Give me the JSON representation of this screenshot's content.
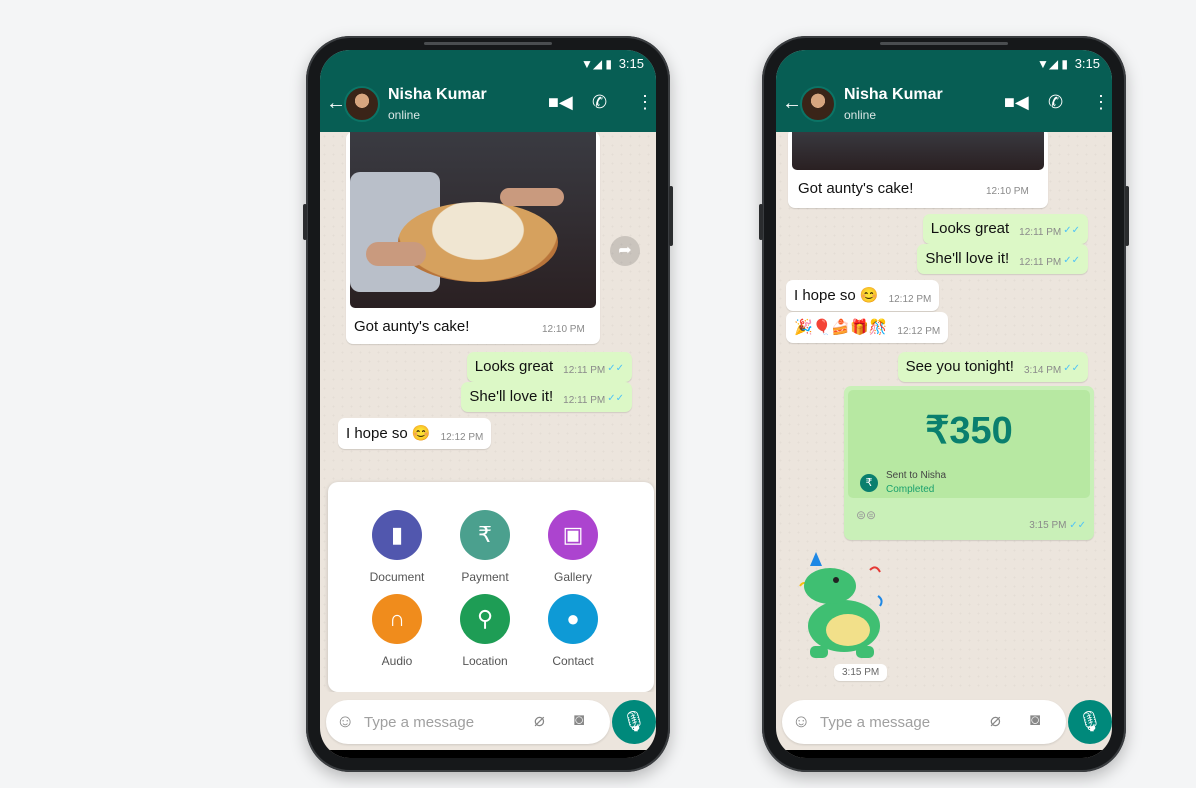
{
  "status_bar": {
    "time": "3:15"
  },
  "contact": {
    "name": "Nisha Kumar",
    "status": "online"
  },
  "left_phone": {
    "image_caption": "Got aunty's cake!",
    "image_caption_time": "12:10 PM",
    "messages": [
      {
        "text": "Looks great",
        "time": "12:11 PM",
        "dir": "out"
      },
      {
        "text": "She'll love it!",
        "time": "12:11 PM",
        "dir": "out"
      },
      {
        "text": "I hope so 😊",
        "time": "12:12 PM",
        "dir": "in"
      }
    ],
    "attachments": [
      {
        "label": "Document",
        "icon": "document-icon",
        "color": "#5157ae"
      },
      {
        "label": "Payment",
        "icon": "rupee-icon",
        "color": "#4ba08e"
      },
      {
        "label": "Gallery",
        "icon": "gallery-icon",
        "color": "#ac44cf"
      },
      {
        "label": "Audio",
        "icon": "headphones-icon",
        "color": "#f08c1c"
      },
      {
        "label": "Location",
        "icon": "location-icon",
        "color": "#1e9d55"
      },
      {
        "label": "Contact",
        "icon": "person-icon",
        "color": "#0e9ad6"
      }
    ]
  },
  "right_phone": {
    "image_caption": "Got aunty's cake!",
    "image_caption_time": "12:10 PM",
    "messages": [
      {
        "text": "Looks great",
        "time": "12:11 PM",
        "dir": "out"
      },
      {
        "text": "She'll love it!",
        "time": "12:11 PM",
        "dir": "out"
      },
      {
        "text": "I hope so 😊",
        "time": "12:12 PM",
        "dir": "in"
      },
      {
        "text": "🎉🎈🍰🎁🎊",
        "time": "12:12 PM",
        "dir": "in"
      },
      {
        "text": "See you tonight!",
        "time": "3:14 PM",
        "dir": "out"
      }
    ],
    "payment": {
      "amount": "₹350",
      "recipient_line": "Sent to Nisha",
      "status": "Completed",
      "time": "3:15 PM"
    },
    "sticker_time": "3:15 PM"
  },
  "composer": {
    "placeholder": "Type a message"
  },
  "colors": {
    "header": "#075e54",
    "outgoing_bubble": "#dcf8c6",
    "mic_button": "#00897b"
  }
}
